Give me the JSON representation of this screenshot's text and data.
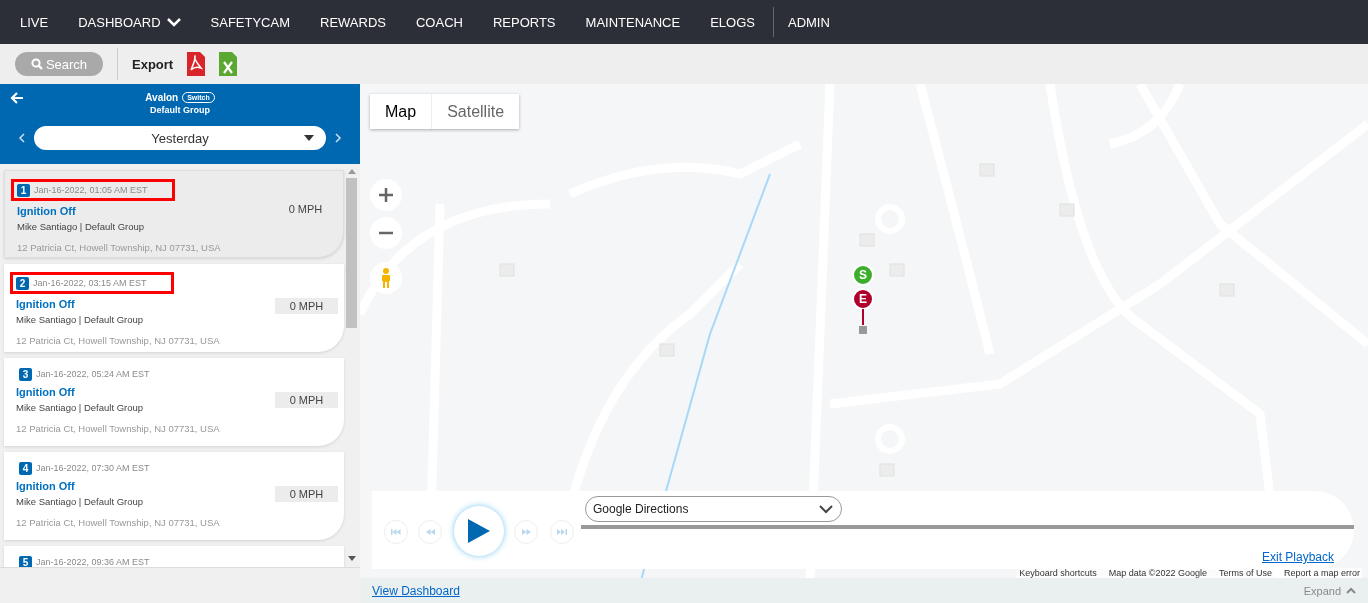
{
  "nav": {
    "items": [
      {
        "label": "LIVE",
        "has_menu": false,
        "separator_before": false
      },
      {
        "label": "DASHBOARD",
        "has_menu": true,
        "separator_before": false
      },
      {
        "label": "SAFETYCAM",
        "has_menu": false,
        "separator_before": false
      },
      {
        "label": "REWARDS",
        "has_menu": false,
        "separator_before": false
      },
      {
        "label": "COACH",
        "has_menu": false,
        "separator_before": false
      },
      {
        "label": "REPORTS",
        "has_menu": false,
        "separator_before": false
      },
      {
        "label": "MAINTENANCE",
        "has_menu": false,
        "separator_before": false
      },
      {
        "label": "ELOGS",
        "has_menu": false,
        "separator_before": false
      },
      {
        "label": "ADMIN",
        "has_menu": false,
        "separator_before": true
      }
    ]
  },
  "toolbar": {
    "search_button": "Search",
    "export_label": "Export"
  },
  "vehicle_header": {
    "name": "Avalon",
    "switch_label": "Switch",
    "group": "Default Group",
    "period": "Yesterday"
  },
  "events": [
    {
      "index": "1",
      "time": "Jan-16-2022, 01:05 AM EST",
      "title": "Ignition Off",
      "driver": "Mike Santiago | Default Group",
      "speed": "0 MPH",
      "address": "12 Patricia Ct, Howell Township, NJ 07731, USA",
      "selected": true,
      "highlighted": true
    },
    {
      "index": "2",
      "time": "Jan-16-2022, 03:15 AM EST",
      "title": "Ignition Off",
      "driver": "Mike Santiago | Default Group",
      "speed": "0 MPH",
      "address": "12 Patricia Ct, Howell Township, NJ 07731, USA",
      "selected": false,
      "highlighted": true
    },
    {
      "index": "3",
      "time": "Jan-16-2022, 05:24 AM EST",
      "title": "Ignition Off",
      "driver": "Mike Santiago | Default Group",
      "speed": "0 MPH",
      "address": "12 Patricia Ct, Howell Township, NJ 07731, USA",
      "selected": false,
      "highlighted": false
    },
    {
      "index": "4",
      "time": "Jan-16-2022, 07:30 AM EST",
      "title": "Ignition Off",
      "driver": "Mike Santiago | Default Group",
      "speed": "0 MPH",
      "address": "12 Patricia Ct, Howell Township, NJ 07731, USA",
      "selected": false,
      "highlighted": false
    },
    {
      "index": "5",
      "time": "Jan-16-2022, 09:36 AM EST",
      "selected": false,
      "highlighted": false
    }
  ],
  "map": {
    "type_buttons": [
      {
        "label": "Map",
        "selected": true
      },
      {
        "label": "Satellite",
        "selected": false
      }
    ],
    "markers": [
      {
        "label": "S",
        "color": "#3dae2b"
      },
      {
        "label": "E",
        "color": "#b0002a"
      }
    ],
    "attribution": [
      "Keyboard shortcuts",
      "Map data ©2022 Google",
      "Terms of Use",
      "Report a map error"
    ]
  },
  "playback": {
    "route_select": "Google Directions",
    "exit_link": "Exit Playback"
  },
  "footer": {
    "view_dashboard": "View Dashboard",
    "expand": "Expand"
  }
}
